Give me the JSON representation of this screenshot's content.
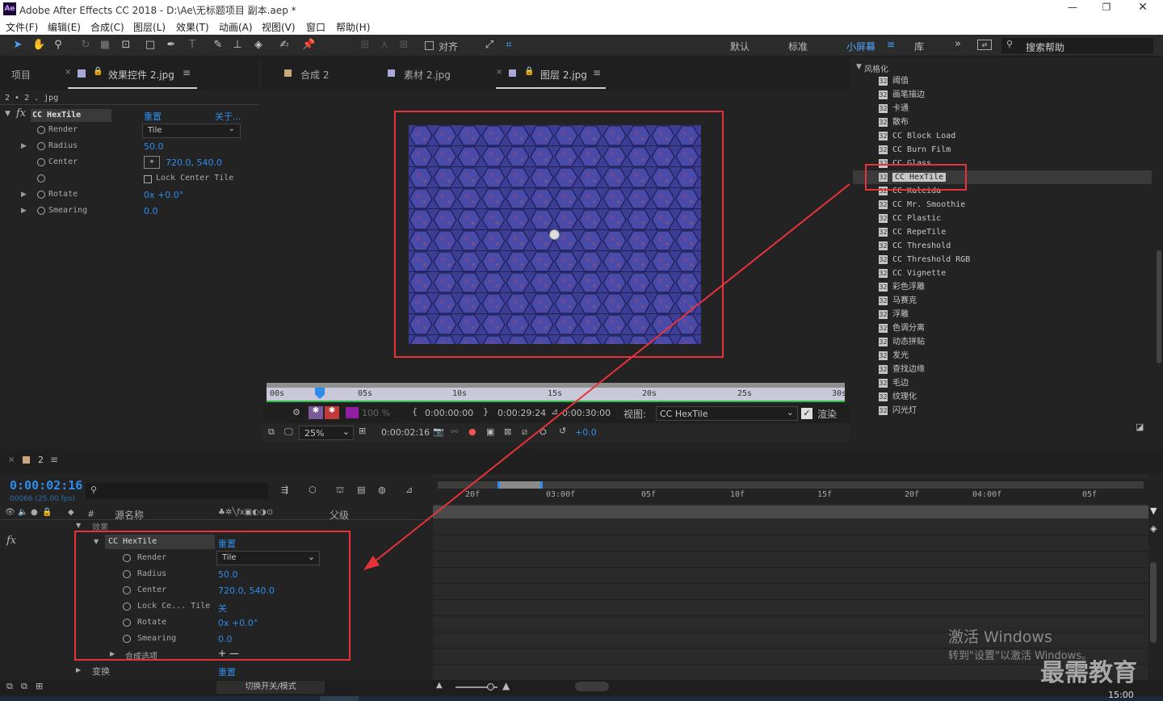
{
  "window": {
    "title": "Adobe After Effects CC 2018 - D:\\Ae\\无标题项目 副本.aep *",
    "app_icon": "Ae"
  },
  "menu": [
    "文件(F)",
    "编辑(E)",
    "合成(C)",
    "图层(L)",
    "效果(T)",
    "动画(A)",
    "视图(V)",
    "窗口",
    "帮助(H)"
  ],
  "toolbar": {
    "align_label": "对齐",
    "workspaces": [
      "默认",
      "标准",
      "小屏幕",
      "库"
    ],
    "search_placeholder": "搜索帮助"
  },
  "left_panel": {
    "tabs": [
      "项目",
      "效果控件 2.jpg"
    ],
    "layer_path": "2 • 2 . jpg",
    "effect_name": "CC HexTile",
    "reset": "重置",
    "about": "关于...",
    "props": [
      {
        "name": "Render",
        "value": "Tile"
      },
      {
        "name": "Radius",
        "value": "50.0"
      },
      {
        "name": "Center",
        "value": "720.0, 540.0"
      },
      {
        "name": "",
        "value": "Lock Center Tile"
      },
      {
        "name": "Rotate",
        "value": "0x +0.0°"
      },
      {
        "name": "Smearing",
        "value": "0.0"
      }
    ]
  },
  "viewer": {
    "tabs": [
      "合成 2",
      "素材 2.jpg",
      "图层 2.jpg"
    ],
    "ruler": [
      "00s",
      "05s",
      "10s",
      "15s",
      "20s",
      "25s",
      "30s"
    ],
    "opacity": "100 %",
    "time_in": "0:00:00:00",
    "time_out": "0:00:29:24",
    "duration": "0:00:30:00",
    "view_label": "视图:",
    "view_value": "CC HexTile",
    "render_label": "渲染",
    "zoom": "25%",
    "current_time": "0:00:02:16",
    "exposure": "+0.0"
  },
  "effects_panel": {
    "category": "风格化",
    "items": [
      "阈值",
      "画笔描边",
      "卡通",
      "散布",
      "CC Block Load",
      "CC Burn Film",
      "CC Glass",
      "CC HexTile",
      "CC Kaleida",
      "CC Mr. Smoothie",
      "CC Plastic",
      "CC RepeTile",
      "CC Threshold",
      "CC Threshold RGB",
      "CC Vignette",
      "彩色浮雕",
      "马赛克",
      "浮雕",
      "色调分离",
      "动态拼贴",
      "发光",
      "查找边缘",
      "毛边",
      "纹理化",
      "闪光灯"
    ],
    "selected": "CC HexTile"
  },
  "timeline": {
    "comp_name": "2",
    "time": "0:00:02:16",
    "frames": "00066 (25.00 fps)",
    "col_num": "#",
    "col_source": "源名称",
    "col_parent": "父级",
    "effects_group": "效果",
    "effect_name": "CC HexTile",
    "reset": "重置",
    "props": [
      {
        "name": "Render",
        "value": "Tile"
      },
      {
        "name": "Radius",
        "value": "50.0"
      },
      {
        "name": "Center",
        "value": "720.0, 540.0"
      },
      {
        "name": "Lock Ce... Tile",
        "value": "关"
      },
      {
        "name": "Rotate",
        "value": "0x +0.0°"
      },
      {
        "name": "Smearing",
        "value": "0.0"
      }
    ],
    "composite": "合成选项",
    "composite_value": "+ —",
    "transform": "变换",
    "transform_value": "重置",
    "ruler": [
      "20f",
      "03:00f",
      "05f",
      "10f",
      "15f",
      "20f",
      "04:00f",
      "05f"
    ],
    "toggle_label": "切换开关/模式"
  },
  "watermark": {
    "activate_title": "激活 Windows",
    "activate_sub": "转到\"设置\"以激活 Windows。",
    "brand": "最需教育"
  },
  "clock": "15:00"
}
